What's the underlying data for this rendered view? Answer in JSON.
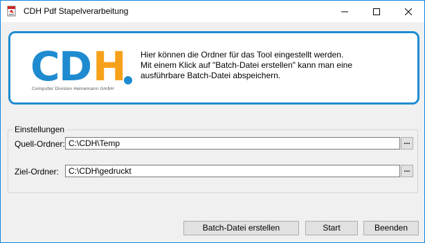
{
  "window": {
    "title": "CDH Pdf Stapelverarbeitung"
  },
  "header": {
    "logo_letters": [
      "C",
      "D",
      "H"
    ],
    "logo_tagline": "Computer Division Heinemann GmbH",
    "info_lines": [
      "Hier können die Ordner für das Tool eingestellt werden.",
      "Mit einem Klick auf \"Batch-Datei erstellen\" kann man eine",
      "ausführbare Batch-Datei abspeichern."
    ]
  },
  "settings": {
    "legend": "Einstellungen",
    "source_label": "Quell-Ordner:",
    "source_value": "C:\\CDH\\Temp",
    "target_label": "Ziel-Ordner:",
    "target_value": "C:\\CDH\\gedruckt",
    "browse_label": "..."
  },
  "buttons": {
    "batch": "Batch-Datei erstellen",
    "start": "Start",
    "quit": "Beenden"
  },
  "colors": {
    "accent_blue": "#1e8bd0",
    "logo_orange": "#f7a11a"
  }
}
